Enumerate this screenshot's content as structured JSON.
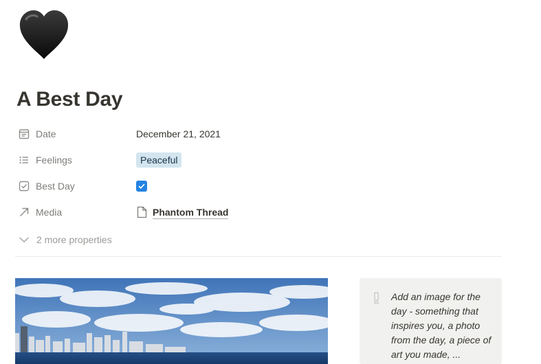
{
  "page": {
    "icon": "black-heart-icon",
    "title": "A Best Day"
  },
  "properties": [
    {
      "name": "Date",
      "icon": "calendar-icon",
      "value": "December 21, 2021"
    },
    {
      "name": "Feelings",
      "icon": "list-icon",
      "value": "Peaceful"
    },
    {
      "name": "Best Day",
      "icon": "checkbox-icon",
      "checked": true
    },
    {
      "name": "Media",
      "icon": "arrow-up-right-icon",
      "value": "Phantom Thread",
      "value_icon": "document-icon"
    }
  ],
  "more_properties": "2 more properties",
  "callout": {
    "icon": "exclamation-icon",
    "text": "Add an image for the day - something that inspires you, a photo from the day, a piece of art you made, ..."
  },
  "colors": {
    "text": "#37352f",
    "tag_bg": "#d3e5ef",
    "checkbox": "#2383e2",
    "callout_bg": "#f1f1ef"
  }
}
